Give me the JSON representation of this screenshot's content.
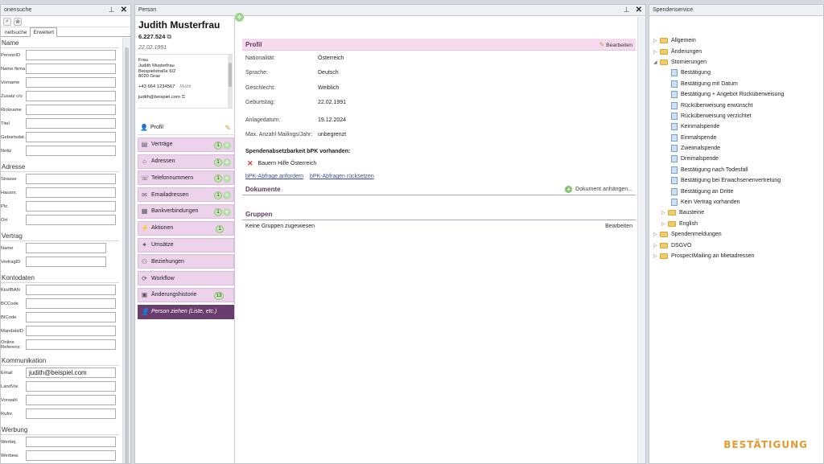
{
  "left_pane": {
    "title": "onensuche",
    "tabs": [
      "nellsuche",
      "Erweitert"
    ],
    "groups": [
      {
        "title": "Name",
        "fields": [
          {
            "label": "PersonID",
            "value": ""
          },
          {
            "label": "Name firma",
            "value": ""
          },
          {
            "label": "Vorname",
            "value": ""
          },
          {
            "label": "Zusatz c/o",
            "value": ""
          },
          {
            "label": "Rickname",
            "value": ""
          },
          {
            "label": "Titel",
            "value": ""
          },
          {
            "label": "Geburtsdat.",
            "value": ""
          },
          {
            "label": "Notiz",
            "value": ""
          }
        ]
      },
      {
        "title": "Adresse",
        "fields": [
          {
            "label": "Strasse",
            "value": ""
          },
          {
            "label": "Hausnr.",
            "value": ""
          },
          {
            "label": "Plz.",
            "value": ""
          },
          {
            "label": "Ort",
            "value": ""
          }
        ]
      },
      {
        "title": "Vertrag",
        "fields": [
          {
            "label": "Name",
            "value": ""
          },
          {
            "label": "VertragID",
            "value": ""
          }
        ]
      },
      {
        "title": "Kontodaten",
        "fields": [
          {
            "label": "Kto/IBAN",
            "value": ""
          },
          {
            "label": "BCCode",
            "value": ""
          },
          {
            "label": "BICode",
            "value": ""
          },
          {
            "label": "MandatsID",
            "value": ""
          },
          {
            "label": "Online Referenz:",
            "value": ""
          }
        ]
      },
      {
        "title": "Kommunikation",
        "fields": [
          {
            "label": "Email",
            "value": "judith@beispiel.com"
          },
          {
            "label": "LandVw.",
            "value": ""
          },
          {
            "label": "Vorwahl",
            "value": ""
          },
          {
            "label": "Rufnr.",
            "value": ""
          }
        ]
      },
      {
        "title": "Werbung",
        "fields": [
          {
            "label": "Werbej.",
            "value": ""
          },
          {
            "label": "Werbew.",
            "value": ""
          }
        ]
      }
    ]
  },
  "person_pane": {
    "title": "Person",
    "name": "Judith Musterfrau",
    "id": "6.227.524",
    "birthdate": "22.02.1991",
    "address": [
      "Frau",
      "Judith Musterfrau",
      "Beispielstraße 6/2",
      "8020 Graz"
    ],
    "phone": "+43 664 1234567",
    "phone_type": "Mobil",
    "email": "judith@beispiel.com",
    "nav": [
      {
        "label": "Profil",
        "icon": "user-icon"
      },
      {
        "label": "Verträge",
        "icon": "contract-icon",
        "badge": "1"
      },
      {
        "label": "Adressen",
        "icon": "house-icon",
        "badge": "1"
      },
      {
        "label": "Telefonnummern",
        "icon": "phone-icon",
        "badge": "1"
      },
      {
        "label": "Emailadressen",
        "icon": "mail-icon",
        "badge": "1"
      },
      {
        "label": "Bankverbindungen",
        "icon": "bank-icon",
        "badge": "1"
      },
      {
        "label": "Aktionen",
        "icon": "action-icon",
        "badge": "1"
      },
      {
        "label": "Umsätze",
        "icon": "money-icon"
      },
      {
        "label": "Beziehungen",
        "icon": "relations-icon"
      },
      {
        "label": "Workflow",
        "icon": "workflow-icon"
      },
      {
        "label": "Änderungshistorie",
        "icon": "history-icon",
        "badge": "13"
      },
      {
        "label": "Person ziehen (Liste, etc.)",
        "icon": "drag-person-icon"
      }
    ],
    "profile": {
      "header": "Profil",
      "edit_label": "Bearbeiten",
      "rows": [
        {
          "label": "Nationalität:",
          "value": "Österreich"
        },
        {
          "label": "Sprache:",
          "value": "Deutsch"
        },
        {
          "label": "Geschlecht:",
          "value": "Weiblich"
        },
        {
          "label": "Geburtstag:",
          "value": "22.02.1991"
        },
        {
          "label": "Anlagedatum:",
          "value": "19.12.2024"
        },
        {
          "label": "Max. Anzahl Mailings/Jahr:",
          "value": "unbegrenzt"
        }
      ],
      "bpk_title": "Spendenabsetzbarkeit bPK vorhanden:",
      "bpk_entry": "Bauern Hilfe Österreich",
      "bpk_link_request": "bPK-Abfrage anfordern",
      "bpk_link_reset": "bPK-Abfragen rücksetzen"
    },
    "documents": {
      "header": "Dokumente",
      "add_label": "Dokument anhängen..."
    },
    "groups": {
      "header": "Gruppen",
      "empty_text": "Keine Gruppen zugewiesen",
      "edit_label": "Bearbeiten"
    }
  },
  "right_pane": {
    "title": "Spendenservice",
    "tree": [
      {
        "label": "Allgemein",
        "type": "folder",
        "level": 0,
        "arrow": "▷"
      },
      {
        "label": "Änderungen",
        "type": "folder",
        "level": 0,
        "arrow": "▷"
      },
      {
        "label": "Stornierungen",
        "type": "folder",
        "level": 0,
        "arrow": "◢"
      },
      {
        "label": "Bestätigung",
        "type": "page",
        "level": 1
      },
      {
        "label": "Bestätigung mit Datum",
        "type": "page",
        "level": 1
      },
      {
        "label": "Bestätigung + Angebot Rücküberweisung",
        "type": "page",
        "level": 1
      },
      {
        "label": "Rücküberweisung erwünscht",
        "type": "page",
        "level": 1
      },
      {
        "label": "Rücküberweisung verzichtet",
        "type": "page",
        "level": 1
      },
      {
        "label": "Keinmalspende",
        "type": "page",
        "level": 1
      },
      {
        "label": "Einmalspende",
        "type": "page",
        "level": 1
      },
      {
        "label": "Zweimalspende",
        "type": "page",
        "level": 1
      },
      {
        "label": "Dreimalspende",
        "type": "page",
        "level": 1
      },
      {
        "label": "Bestätigung nach Todesfall",
        "type": "page",
        "level": 1
      },
      {
        "label": "Bestätigung bei Erwachsenenvertretung",
        "type": "page",
        "level": 1
      },
      {
        "label": "Bestätigung an Dritte",
        "type": "page",
        "level": 1
      },
      {
        "label": "Kein Vertrag vorhanden",
        "type": "page",
        "level": 1
      },
      {
        "label": "Bausteine",
        "type": "folder",
        "level": 1,
        "arrow": "▷"
      },
      {
        "label": "English",
        "type": "folder",
        "level": 1,
        "arrow": "▷"
      },
      {
        "label": "Spendenmeldungen",
        "type": "folder",
        "level": 0,
        "arrow": "▷"
      },
      {
        "label": "DSGVO",
        "type": "folder",
        "level": 0,
        "arrow": "▷"
      },
      {
        "label": "ProspectMailing an Mietadressen",
        "type": "folder",
        "level": 0,
        "arrow": "▷"
      }
    ]
  },
  "overlay_logo": "BESTÄTIGUNG"
}
